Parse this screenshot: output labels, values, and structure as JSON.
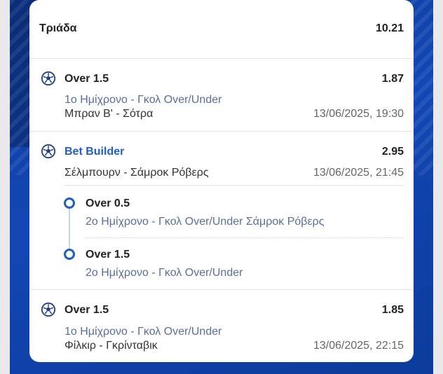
{
  "summary": {
    "label": "Τριάδα",
    "total_odds": "10.21"
  },
  "selections": [
    {
      "pick": "Over 1.5",
      "odds": "1.87",
      "market": "1ο Ημίχρονο - Γκολ Over/Under",
      "event": "Μπραν Β' - Σότρα",
      "datetime": "13/06/2025, 19:30",
      "icon": "football-icon"
    },
    {
      "pick": "Bet Builder",
      "odds": "2.95",
      "event": "Σέλμπουρν - Σάμροκ Ρόβερς",
      "datetime": "13/06/2025, 21:45",
      "icon": "football-icon",
      "legs": [
        {
          "pick": "Over 0.5",
          "market": "2ο Ημίχρονο - Γκολ Over/Under Σάμροκ Ρόβερς"
        },
        {
          "pick": "Over 1.5",
          "market": "2ο Ημίχρονο - Γκολ Over/Under"
        }
      ]
    },
    {
      "pick": "Over 1.5",
      "odds": "1.85",
      "market": "1ο Ημίχρονο - Γκολ Over/Under",
      "event": "Φίλκιρ - Γκρίνταβικ",
      "datetime": "13/06/2025, 22:15",
      "icon": "football-icon"
    }
  ],
  "colors": {
    "accent": "#1f5fc2",
    "background": "#1247b4",
    "card": "#ffffff"
  }
}
